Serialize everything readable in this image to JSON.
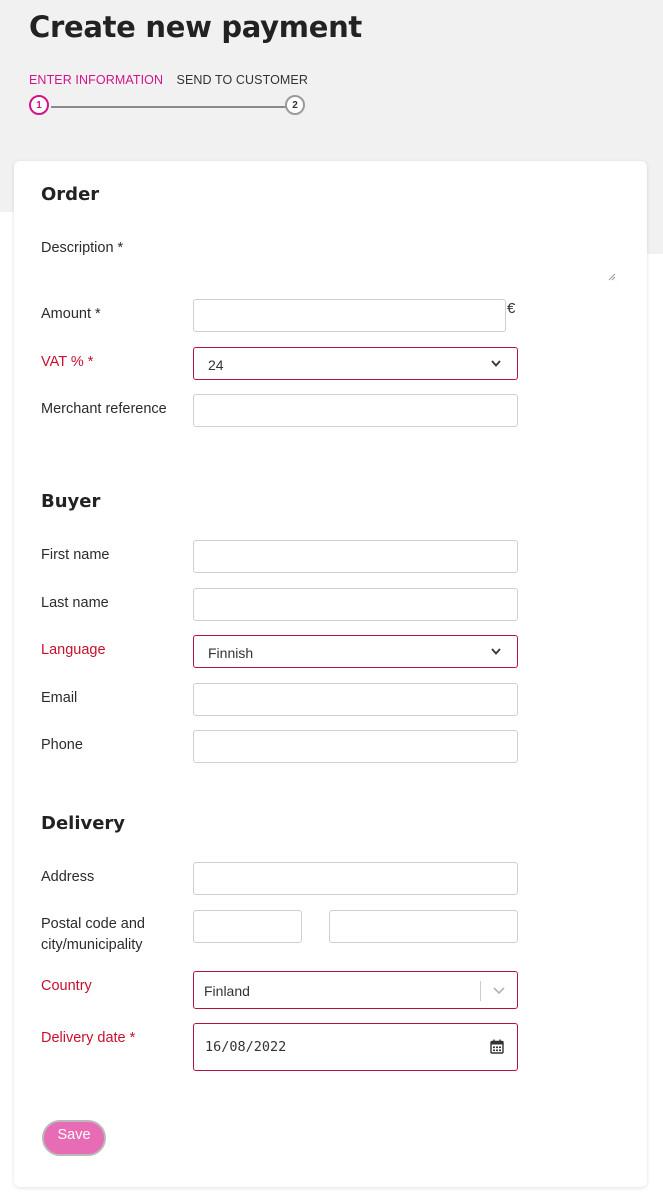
{
  "page": {
    "title": "Create new payment"
  },
  "stepper": {
    "steps": [
      {
        "label": "ENTER INFORMATION",
        "number": "1",
        "state": "active"
      },
      {
        "label": "SEND TO CUSTOMER",
        "number": "2",
        "state": "inactive"
      }
    ]
  },
  "order": {
    "title": "Order",
    "description_label": "Description *",
    "description_value": "",
    "amount_label": "Amount *",
    "amount_value": "",
    "currency_symbol": "€",
    "vat_label": "VAT % *",
    "vat_value": "24",
    "merchant_reference_label": "Merchant reference",
    "merchant_reference_value": ""
  },
  "buyer": {
    "title": "Buyer",
    "first_name_label": "First name",
    "last_name_label": "Last name",
    "language_label": "Language",
    "language_value": "Finnish",
    "email_label": "Email",
    "phone_label": "Phone"
  },
  "delivery": {
    "title": "Delivery",
    "address_label": "Address",
    "postal_city_label": "Postal code and city/municipality",
    "country_label": "Country",
    "country_value": "Finland",
    "date_label": "Delivery date *",
    "date_value": "16/08/2022"
  },
  "actions": {
    "save_label": "Save"
  },
  "colors": {
    "accent": "#d1158a",
    "error": "#c8102e",
    "save_button": "#e86bb5",
    "page_background": "#f1f1f1"
  },
  "icons": {
    "select_arrow": "chevron-down-icon",
    "date_picker": "calendar-icon",
    "textarea_resize": "resize-grip-icon"
  }
}
